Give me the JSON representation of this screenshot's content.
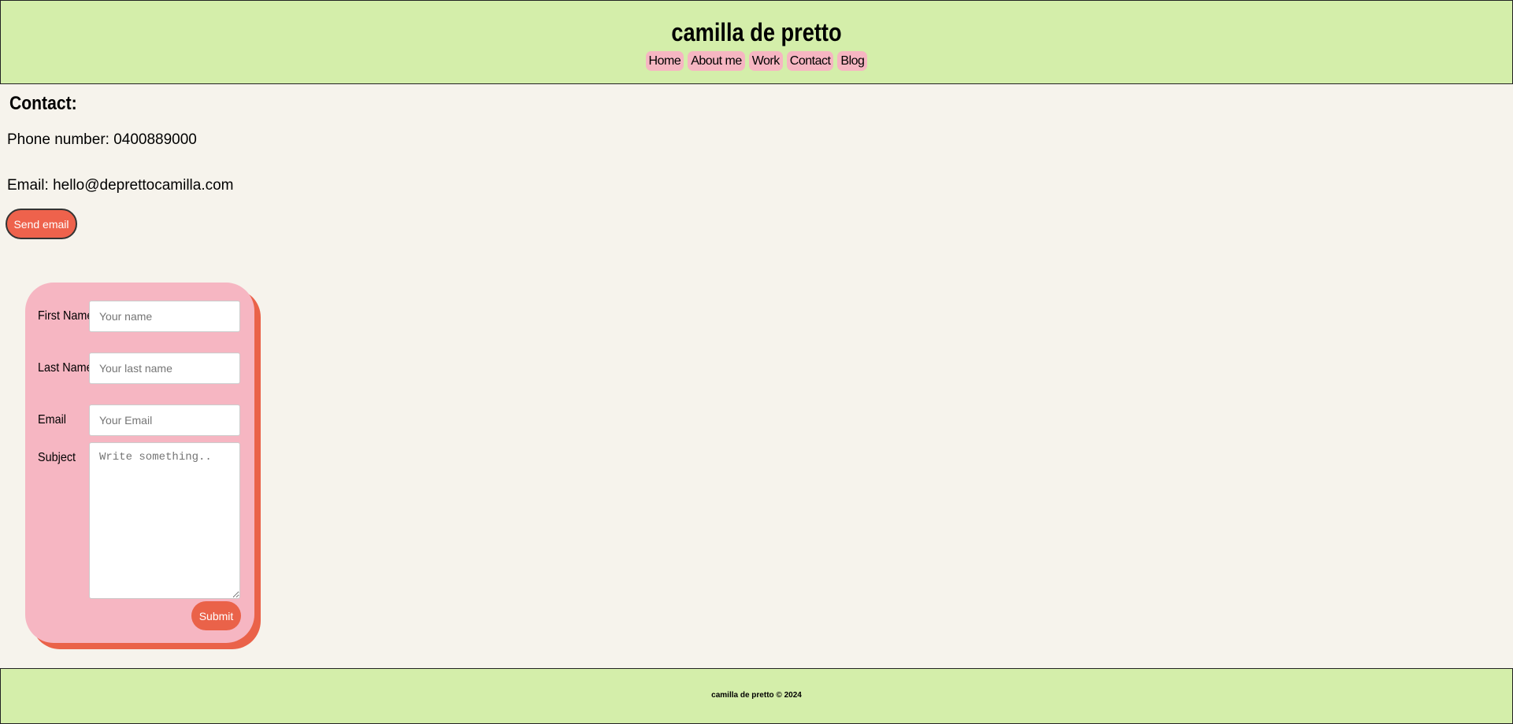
{
  "header": {
    "title": "camilla de pretto",
    "nav": [
      "Home",
      "About me",
      "Work",
      "Contact",
      "Blog"
    ]
  },
  "contact": {
    "heading": "Contact:",
    "phone": "Phone number: 0400889000",
    "email": "Email: hello@deprettocamilla.com",
    "send_label": "Send email"
  },
  "form": {
    "first_label": "First Name",
    "first_placeholder": "Your name",
    "last_label": "Last Name",
    "last_placeholder": "Your last name",
    "email_label": "Email",
    "email_placeholder": "Your Email",
    "subject_label": "Subject",
    "subject_placeholder": "Write something..",
    "submit_label": "Submit"
  },
  "footer": {
    "text": "camilla de pretto © 2024"
  },
  "colors": {
    "header_bg": "#d4eeaa",
    "nav_pill": "#f6b6c2",
    "accent": "#ea6249",
    "page_bg": "#f6f3ec"
  }
}
